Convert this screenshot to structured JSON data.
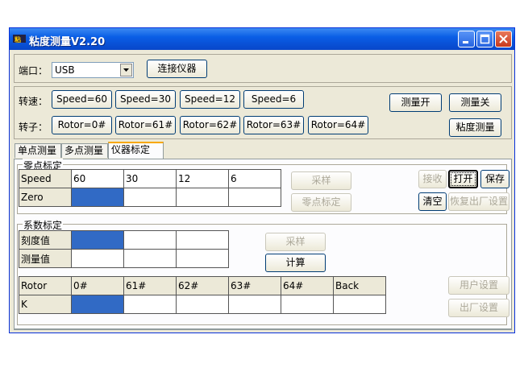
{
  "window": {
    "title": "粘度测量V2.20",
    "app_icon_text": "Ȣ"
  },
  "port": {
    "label": "端口：",
    "value": "USB",
    "connect_button": "连接仪器"
  },
  "speed_row": {
    "label": "转速：",
    "buttons": [
      "Speed=60",
      "Speed=30",
      "Speed=12",
      "Speed=6"
    ]
  },
  "rotor_row": {
    "label": "转子：",
    "buttons": [
      "Rotor=0#",
      "Rotor=61#",
      "Rotor=62#",
      "Rotor=63#",
      "Rotor=64#"
    ]
  },
  "measure": {
    "open": "测量开",
    "close": "测量关",
    "viscosity": "粘度测量"
  },
  "tabs": [
    "单点测量",
    "多点测量",
    "仪器标定"
  ],
  "active_tab": "仪器标定",
  "zero_cal": {
    "legend": "零点标定",
    "row_headers": [
      "Speed",
      "Zero"
    ],
    "speed_values": [
      "60",
      "30",
      "12",
      "6"
    ],
    "sample_button": "采样",
    "zero_cal_button": "零点标定"
  },
  "coef_cal": {
    "legend": "系数标定",
    "row_headers": [
      "刻度值",
      "测量值"
    ],
    "sample_button": "采样",
    "calc_button": "计算",
    "rotor_header": "Rotor",
    "rotor_columns": [
      "0#",
      "61#",
      "62#",
      "63#",
      "64#",
      "Back"
    ],
    "k_label": "K"
  },
  "right_buttons": {
    "receive": "接收",
    "open": "打开",
    "save": "保存",
    "clear": "清空",
    "restore": "恢复出厂设置",
    "user_settings": "用户设置",
    "factory_settings": "出厂设置"
  },
  "colors": {
    "titlebar": "#0a5ee6",
    "selected_cell": "#316ac5",
    "window_bg": "#ece9d8"
  }
}
